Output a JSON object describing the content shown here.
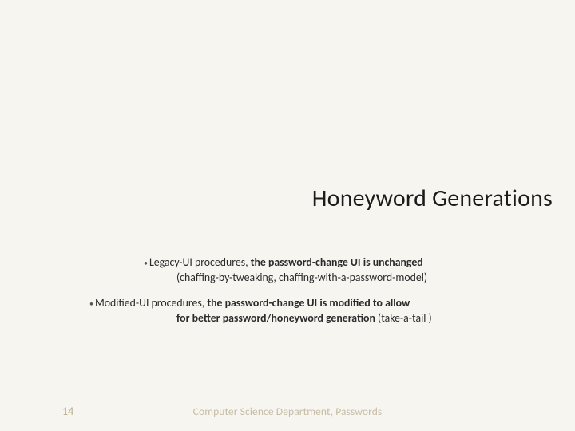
{
  "title": "Honeyword Generations",
  "bullets": {
    "item1": {
      "dot": "•",
      "lead": "Legacy-UI procedures,  ",
      "bold": "the password-change UI is unchanged",
      "sub": "(chaffing-by-tweaking, chaffing-with-a-password-model)"
    },
    "item2": {
      "dot": "•",
      "lead": "Modified-UI procedures, ",
      "bold1": "the password-change UI is modified to allow",
      "bold2": "for better password/honeyword generation ",
      "tail": "(take-a-tail )"
    }
  },
  "page_number": "14",
  "footer": "Computer Science Department, Passwords"
}
